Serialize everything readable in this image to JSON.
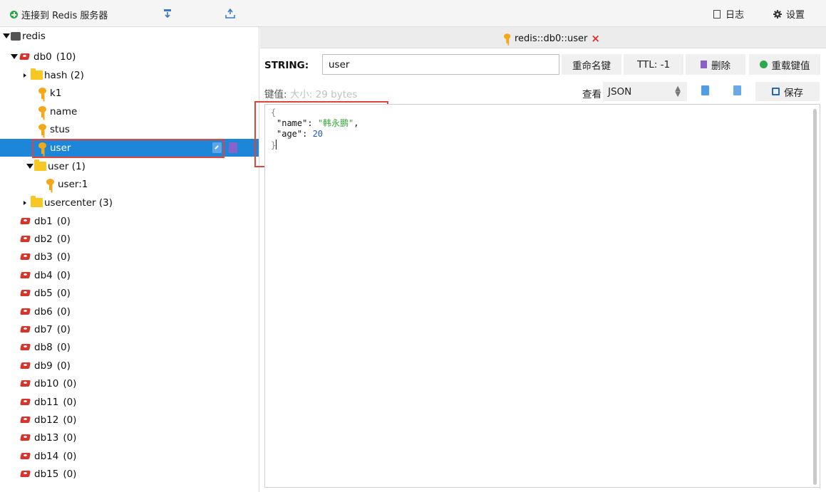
{
  "toolbar": {
    "connect_label": "连接到 Redis 服务器",
    "log_label": "日志",
    "settings_label": "设置"
  },
  "tree": {
    "server_label": "redis",
    "db0_label": "db0",
    "db0_count": "(10)",
    "items": [
      {
        "label": "hash (2)"
      },
      {
        "label": "k1"
      },
      {
        "label": "name"
      },
      {
        "label": "stus"
      },
      {
        "label": "user"
      },
      {
        "label": "user (1)"
      },
      {
        "label": "user:1"
      },
      {
        "label": "usercenter (3)"
      }
    ],
    "dbs": [
      {
        "label": "db1",
        "count": "(0)"
      },
      {
        "label": "db2",
        "count": "(0)"
      },
      {
        "label": "db3",
        "count": "(0)"
      },
      {
        "label": "db4",
        "count": "(0)"
      },
      {
        "label": "db5",
        "count": "(0)"
      },
      {
        "label": "db6",
        "count": "(0)"
      },
      {
        "label": "db7",
        "count": "(0)"
      },
      {
        "label": "db8",
        "count": "(0)"
      },
      {
        "label": "db9",
        "count": "(0)"
      },
      {
        "label": "db10",
        "count": "(0)"
      },
      {
        "label": "db11",
        "count": "(0)"
      },
      {
        "label": "db12",
        "count": "(0)"
      },
      {
        "label": "db13",
        "count": "(0)"
      },
      {
        "label": "db14",
        "count": "(0)"
      },
      {
        "label": "db15",
        "count": "(0)"
      }
    ]
  },
  "tab": {
    "title": "redis::db0::user",
    "close": "×"
  },
  "key_panel": {
    "type": "STRING:",
    "key_name": "user",
    "rename_label": "重命名键",
    "ttl_label": "TTL: -1",
    "delete_label": "删除",
    "reload_label": "重载键值",
    "value_label": "键值:",
    "size_label": "大小: 29 bytes",
    "view_label": "查看",
    "format": "JSON",
    "save_label": "保存"
  },
  "editor": {
    "open_brace": "{",
    "line1_key": "\"name\"",
    "line1_sep": ": ",
    "line1_val": "\"韩永鹏\"",
    "line1_end": ",",
    "line2_key": "\"age\"",
    "line2_sep": ": ",
    "line2_val": "20",
    "close_brace": "}"
  },
  "colors": {
    "selection": "#1d86d8",
    "highlight": "#e0443a",
    "json_string": "#3aa63a",
    "json_number": "#2255cc"
  }
}
